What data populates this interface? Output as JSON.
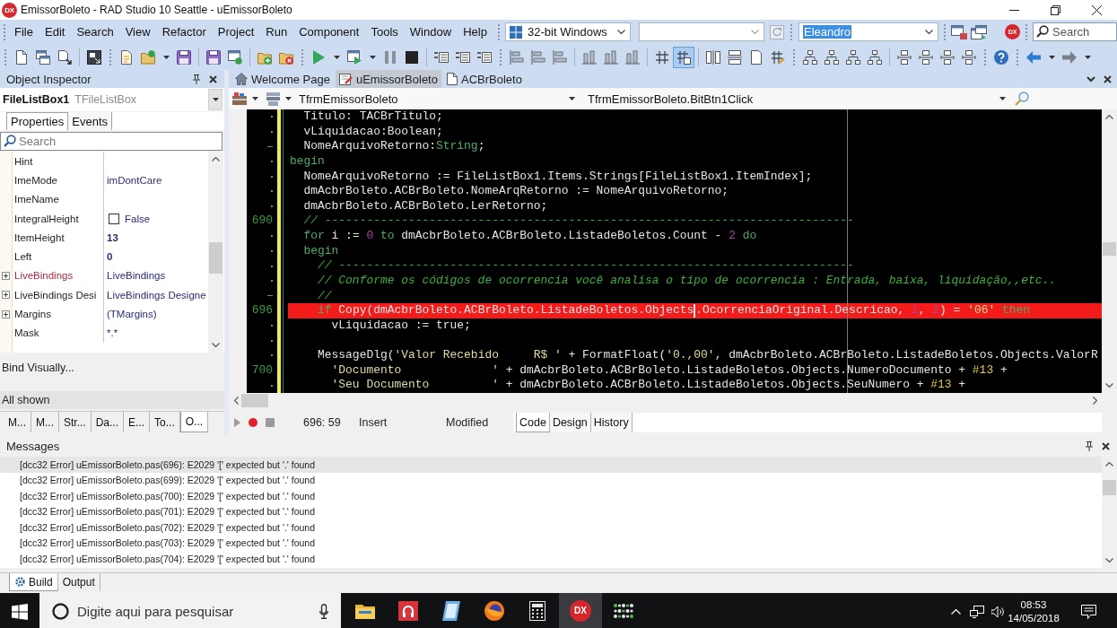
{
  "window": {
    "logo": "DX",
    "title": "EmissorBoleto - RAD Studio 10 Seattle - uEmissorBoleto"
  },
  "menu": [
    "File",
    "Edit",
    "Search",
    "View",
    "Refactor",
    "Project",
    "Run",
    "Component",
    "Tools",
    "Window",
    "Help"
  ],
  "toolbar": {
    "platform": "32-bit Windows",
    "desktop": "Eleandro",
    "desktop_text_selected": true,
    "account_badge": "DX",
    "search_placeholder": "Search",
    "toggles": [
      {
        "on": false
      },
      {
        "on": true
      }
    ]
  },
  "object_inspector": {
    "title": "Object Inspector",
    "component": "FileListBox1",
    "component_type": "TFileListBox",
    "tabs": [
      {
        "label": "Properties",
        "selected": true
      },
      {
        "label": "Events",
        "selected": false
      }
    ],
    "search_placeholder": "Search",
    "properties": [
      {
        "name": "Hint",
        "kind": "text",
        "expandable": false,
        "name_highlighted": false
      },
      {
        "name": "ImeMode",
        "kind": "text",
        "value": "imDontCare",
        "expandable": false,
        "name_highlighted": false,
        "non_default": false
      },
      {
        "name": "ImeName",
        "kind": "text",
        "expandable": false,
        "name_highlighted": false
      },
      {
        "name": "IntegralHeight",
        "kind": "checkbox",
        "value": "False",
        "checked": false,
        "expandable": false,
        "name_highlighted": false,
        "non_default": false
      },
      {
        "name": "ItemHeight",
        "kind": "text",
        "value": "13",
        "expandable": false,
        "name_highlighted": false,
        "non_default": true
      },
      {
        "name": "Left",
        "kind": "text",
        "value": "0",
        "expandable": false,
        "name_highlighted": false,
        "non_default": true
      },
      {
        "name": "LiveBindings",
        "kind": "text",
        "value": "LiveBindings",
        "expandable": true,
        "name_highlighted": true,
        "non_default": false
      },
      {
        "name": "LiveBindings Desi",
        "kind": "text",
        "value": "LiveBindings Designe",
        "expandable": true,
        "name_highlighted": false,
        "non_default": false
      },
      {
        "name": "Margins",
        "kind": "text",
        "value": "(TMargins)",
        "expandable": true,
        "name_highlighted": false,
        "non_default": false
      },
      {
        "name": "Mask",
        "kind": "text",
        "value": "*.*",
        "expandable": false,
        "name_highlighted": false,
        "non_default": false
      }
    ],
    "bind_link": "Bind Visually...",
    "filter_status": "All shown",
    "bottom_tabs": [
      {
        "label": "M...",
        "selected": false
      },
      {
        "label": "M...",
        "selected": false
      },
      {
        "label": "Str...",
        "selected": false
      },
      {
        "label": "Da...",
        "selected": false
      },
      {
        "label": "E...",
        "selected": false
      },
      {
        "label": "To...",
        "selected": false
      },
      {
        "label": "O...",
        "selected": true
      }
    ]
  },
  "editor": {
    "tabs": [
      {
        "label": "Welcome Page",
        "selected": false
      },
      {
        "label": "uEmissorBoleto",
        "selected": true
      },
      {
        "label": "ACBrBoleto",
        "selected": false
      }
    ],
    "class_combo": "TfrmEmissorBoleto",
    "method_combo": "TfrmEmissorBoleto.BitBtn1Click",
    "lines": [
      {
        "gutter": {
          "kind": "dot"
        },
        "modified": true,
        "error": false,
        "segments": [
          {
            "kind": "plain",
            "text": "  Titulo: TACBrTitulo;"
          }
        ]
      },
      {
        "gutter": {
          "kind": "dot"
        },
        "modified": true,
        "error": false,
        "segments": [
          {
            "kind": "plain",
            "text": "  vLiquidacao:Boolean;"
          }
        ]
      },
      {
        "gutter": {
          "kind": "dash"
        },
        "modified": true,
        "error": false,
        "segments": [
          {
            "kind": "plain",
            "text": "  NomeArquivoRetorno:"
          },
          {
            "kind": "keyword",
            "text": "String"
          },
          {
            "kind": "plain",
            "text": ";"
          }
        ]
      },
      {
        "gutter": {
          "kind": "dot"
        },
        "modified": true,
        "error": false,
        "segments": [
          {
            "kind": "keyword",
            "text": "begin"
          }
        ]
      },
      {
        "gutter": {
          "kind": "dot"
        },
        "modified": true,
        "error": false,
        "segments": [
          {
            "kind": "plain",
            "text": "  NomeArquivoRetorno := FileListBox1.Items.Strings[FileListBox1.ItemIndex];"
          }
        ]
      },
      {
        "gutter": {
          "kind": "dot"
        },
        "modified": true,
        "error": false,
        "segments": [
          {
            "kind": "plain",
            "text": "  dmAcbrBoleto.ACBrBoleto.NomeArqRetorno := NomeArquivoRetorno;"
          }
        ]
      },
      {
        "gutter": {
          "kind": "dot"
        },
        "modified": true,
        "error": false,
        "segments": [
          {
            "kind": "plain",
            "text": "  dmAcbrBoleto.ACBrBoleto.LerRetorno;"
          }
        ]
      },
      {
        "gutter": {
          "kind": "number",
          "text": "690"
        },
        "modified": true,
        "error": false,
        "segments": [
          {
            "kind": "comment",
            "text": "  // ----------------------------------------------------------------------------"
          }
        ]
      },
      {
        "gutter": {
          "kind": "dot"
        },
        "modified": true,
        "error": false,
        "segments": [
          {
            "kind": "keyword",
            "text": "  for"
          },
          {
            "kind": "plain",
            "text": " i := "
          },
          {
            "kind": "number",
            "text": "0"
          },
          {
            "kind": "keyword",
            "text": " to"
          },
          {
            "kind": "plain",
            "text": " dmAcbrBoleto.ACBrBoleto.ListadeBoletos.Count - "
          },
          {
            "kind": "number",
            "text": "2"
          },
          {
            "kind": "keyword",
            "text": " do"
          }
        ]
      },
      {
        "gutter": {
          "kind": "dot"
        },
        "modified": true,
        "error": false,
        "segments": [
          {
            "kind": "keyword",
            "text": "  begin"
          }
        ]
      },
      {
        "gutter": {
          "kind": "dot"
        },
        "modified": true,
        "error": false,
        "segments": [
          {
            "kind": "comment",
            "text": "    // --------------------------------------------------------------------------"
          }
        ]
      },
      {
        "gutter": {
          "kind": "dot"
        },
        "modified": true,
        "error": false,
        "segments": [
          {
            "kind": "comment",
            "text": "    // Conforme os códigos de ocorrencia você analisa o tipo de ocorrencia : Entrada, baixa, liquidação,,etc.."
          }
        ]
      },
      {
        "gutter": {
          "kind": "dash"
        },
        "modified": true,
        "error": false,
        "segments": [
          {
            "kind": "comment",
            "text": "    //"
          }
        ]
      },
      {
        "gutter": {
          "kind": "number",
          "text": "696"
        },
        "modified": true,
        "error": true,
        "segments": [
          {
            "kind": "keyword",
            "text": "    if"
          },
          {
            "kind": "plain",
            "text": " Copy(dmAcbrBoleto.ACBrBoleto.ListadeBoletos.Objects"
          },
          {
            "kind": "cursor"
          },
          {
            "kind": "plain",
            "text": ".OcorrenciaOriginal.Descricao, "
          },
          {
            "kind": "number",
            "text": "1"
          },
          {
            "kind": "plain",
            "text": ", "
          },
          {
            "kind": "number",
            "text": "2"
          },
          {
            "kind": "plain",
            "text": ") = "
          },
          {
            "kind": "string",
            "text": "'06'"
          },
          {
            "kind": "keyword",
            "text": " then"
          }
        ]
      },
      {
        "gutter": {
          "kind": "dot"
        },
        "modified": true,
        "error": false,
        "segments": [
          {
            "kind": "plain",
            "text": "      vLiquidacao := true;"
          }
        ]
      },
      {
        "gutter": {
          "kind": "dot"
        },
        "modified": true,
        "error": false
      },
      {
        "gutter": {
          "kind": "dot"
        },
        "modified": true,
        "error": false,
        "segments": [
          {
            "kind": "plain",
            "text": "    MessageDlg("
          },
          {
            "kind": "string",
            "text": "'Valor Recebido     R$ '"
          },
          {
            "kind": "plain",
            "text": " + FormatFloat("
          },
          {
            "kind": "string",
            "text": "'0.,00'"
          },
          {
            "kind": "plain",
            "text": ", dmAcbrBoleto.ACBrBoleto.ListadeBoletos.Objects.ValorR"
          }
        ]
      },
      {
        "gutter": {
          "kind": "number",
          "text": "700"
        },
        "modified": true,
        "error": false,
        "segments": [
          {
            "kind": "string",
            "text": "      'Documento             '"
          },
          {
            "kind": "plain",
            "text": " + dmAcbrBoleto.ACBrBoleto.ListadeBoletos.Objects.NumeroDocumento + "
          },
          {
            "kind": "char",
            "text": "#13"
          },
          {
            "kind": "plain",
            "text": " +"
          }
        ]
      },
      {
        "gutter": {
          "kind": "dot"
        },
        "modified": true,
        "error": false,
        "segments": [
          {
            "kind": "string",
            "text": "      'Seu Documento         '"
          },
          {
            "kind": "plain",
            "text": " + dmAcbrBoleto.ACBrBoleto.ListadeBoletos.Objects.SeuNumero + "
          },
          {
            "kind": "char",
            "text": "#13"
          },
          {
            "kind": "plain",
            "text": " +"
          }
        ]
      }
    ],
    "status": {
      "position": "696: 59",
      "mode": "Insert",
      "state": "Modified"
    },
    "view_tabs": [
      {
        "label": "Code",
        "selected": true
      },
      {
        "label": "Design",
        "selected": false
      },
      {
        "label": "History",
        "selected": false
      }
    ]
  },
  "messages": {
    "title": "Messages",
    "items": [
      {
        "text": "[dcc32 Error] uEmissorBoleto.pas(696): E2029 '[' expected but '.' found",
        "selected": true
      },
      {
        "text": "[dcc32 Error] uEmissorBoleto.pas(699): E2029 '[' expected but '.' found",
        "selected": false
      },
      {
        "text": "[dcc32 Error] uEmissorBoleto.pas(700): E2029 '[' expected but '.' found",
        "selected": false
      },
      {
        "text": "[dcc32 Error] uEmissorBoleto.pas(701): E2029 '[' expected but '.' found",
        "selected": false
      },
      {
        "text": "[dcc32 Error] uEmissorBoleto.pas(702): E2029 '[' expected but '.' found",
        "selected": false
      },
      {
        "text": "[dcc32 Error] uEmissorBoleto.pas(703): E2029 '[' expected but '.' found",
        "selected": false
      },
      {
        "text": "[dcc32 Error] uEmissorBoleto.pas(704): E2029 '[' expected but '.' found",
        "selected": false
      }
    ],
    "tabs": [
      {
        "label": "Build",
        "selected": true
      },
      {
        "label": "Output",
        "selected": false
      }
    ]
  },
  "taskbar": {
    "search_placeholder": "Digite aqui para pesquisar",
    "apps": [
      {
        "kind": "folder",
        "active": false
      },
      {
        "kind": "tile",
        "active": false
      },
      {
        "kind": "notebook",
        "active": false
      },
      {
        "kind": "globe",
        "active": false
      },
      {
        "kind": "calculator",
        "active": false
      },
      {
        "kind": "logo",
        "label": "DX",
        "active": true
      },
      {
        "kind": "dots",
        "active": false
      }
    ],
    "time": "08:53",
    "date": "14/05/2018"
  }
}
